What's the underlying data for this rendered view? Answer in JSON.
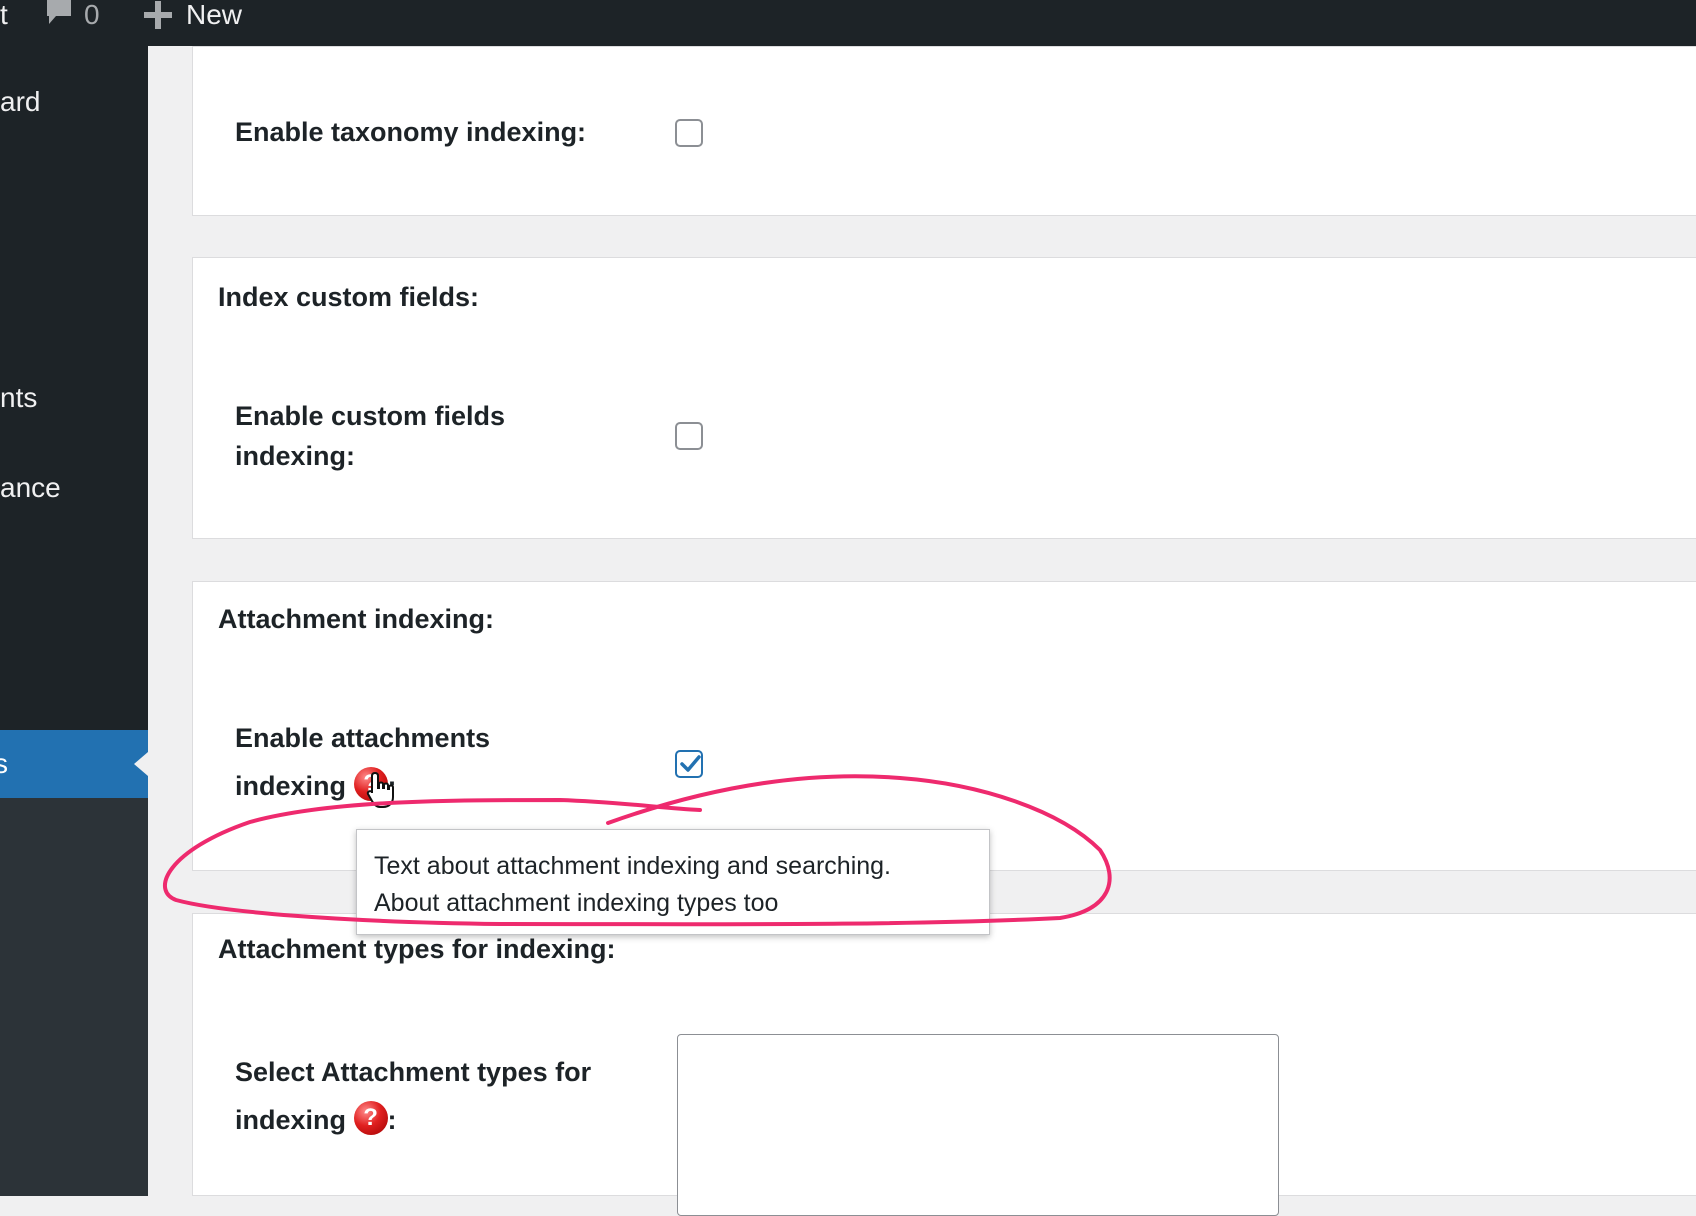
{
  "adminbar": {
    "site_fragment": "t",
    "comments_count": "0",
    "new_label": "New"
  },
  "sidebar": {
    "items": [
      {
        "label": "ard"
      },
      {
        "label": "nts"
      },
      {
        "label": "ance"
      },
      {
        "label": "s"
      }
    ]
  },
  "sections": {
    "taxonomy": {
      "label": "Enable taxonomy indexing:",
      "checked": false
    },
    "custom_fields": {
      "title": "Index custom fields:",
      "label_line1": "Enable custom fields",
      "label_line2": "indexing:",
      "checked": false
    },
    "attachment": {
      "title": "Attachment indexing:",
      "label_line1": "Enable attachments",
      "label_line2": "indexing",
      "label_suffix": ":",
      "checked": true,
      "help_icon": "question-icon"
    },
    "attachment_types": {
      "title": "Attachment types for indexing:",
      "label_line1": "Select Attachment types for",
      "label_line2": "indexing",
      "label_suffix": ":",
      "help_icon": "question-icon"
    }
  },
  "tooltip": {
    "line1": "Text about attachment indexing and searching.",
    "line2": "About attachment indexing types too"
  },
  "colors": {
    "annotation": "#ee2a6e",
    "accent": "#2271b1",
    "adminbar": "#1d2327"
  }
}
